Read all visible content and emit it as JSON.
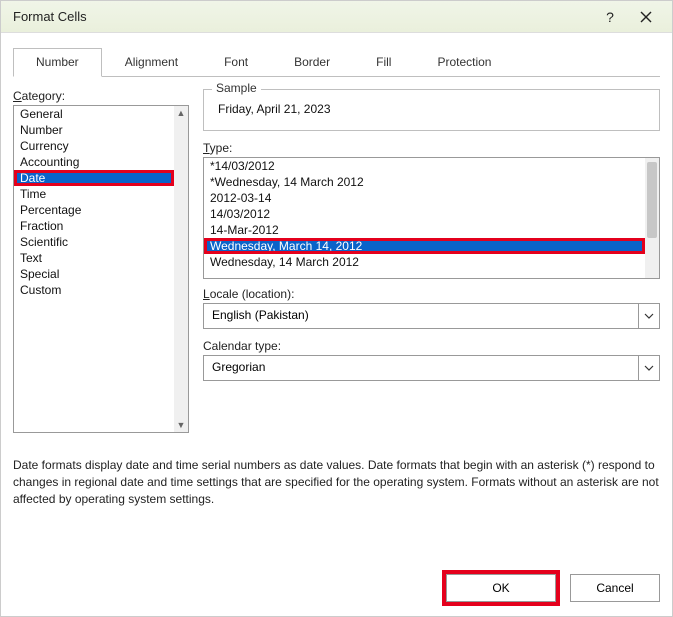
{
  "window": {
    "title": "Format Cells"
  },
  "tabs": {
    "number": "Number",
    "alignment": "Alignment",
    "font": "Font",
    "border": "Border",
    "fill": "Fill",
    "protection": "Protection"
  },
  "labels": {
    "category": "Category:",
    "sample": "Sample",
    "type": "Type:",
    "locale": "Locale (location):",
    "calendar": "Calendar type:"
  },
  "underline": {
    "category_c": "C",
    "type_t": "T",
    "locale_l": "L"
  },
  "category_items": [
    "General",
    "Number",
    "Currency",
    "Accounting",
    "Date",
    "Time",
    "Percentage",
    "Fraction",
    "Scientific",
    "Text",
    "Special",
    "Custom"
  ],
  "category_selected": "Date",
  "sample_value": "Friday, April 21, 2023",
  "type_items": [
    "*14/03/2012",
    "*Wednesday, 14 March 2012",
    "2012-03-14",
    "14/03/2012",
    "14-Mar-2012",
    "Wednesday, March 14, 2012",
    "Wednesday, 14 March 2012"
  ],
  "type_selected": "Wednesday, March 14, 2012",
  "locale_value": "English (Pakistan)",
  "calendar_value": "Gregorian",
  "description": "Date formats display date and time serial numbers as date values.  Date formats that begin with an asterisk (*) respond to changes in regional date and time settings that are specified for the operating system.  Formats without an asterisk are not affected by operating system settings.",
  "buttons": {
    "ok": "OK",
    "cancel": "Cancel"
  }
}
